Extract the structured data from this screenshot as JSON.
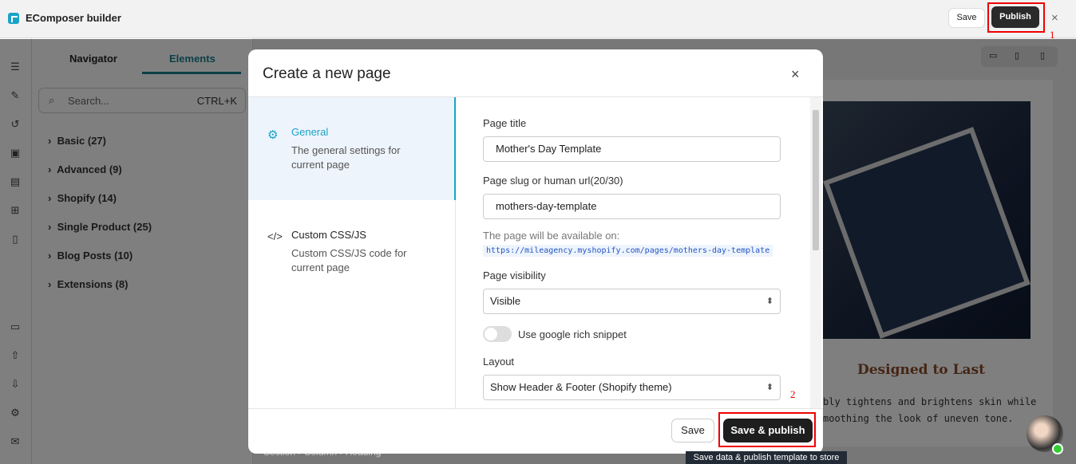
{
  "app": {
    "title": "EComposer builder",
    "save": "Save",
    "publish": "Publish",
    "close": "×",
    "annotation_1": "1"
  },
  "panel": {
    "tabs": [
      "Navigator",
      "Elements"
    ],
    "active_tab": "Elements",
    "search_placeholder": "Search...",
    "search_shortcut": "CTRL+K",
    "categories": [
      "Basic (27)",
      "Advanced (9)",
      "Shopify (14)",
      "Single Product (25)",
      "Blog Posts (10)",
      "Extensions (8)"
    ]
  },
  "canvas": {
    "heading": "Designed to Last",
    "text_lines": [
      "bly tightens and brightens skin while",
      "moothing the look of uneven tone."
    ],
    "breadcrumb": [
      "Section",
      "Column",
      "Heading"
    ]
  },
  "modal": {
    "title": "Create a new page",
    "close": "×",
    "nav": [
      {
        "label": "General",
        "desc": "The general settings for current page",
        "icon": "gear-icon",
        "active": true
      },
      {
        "label": "Custom CSS/JS",
        "desc": "Custom CSS/JS code for current page",
        "icon": "code-icon",
        "active": false
      }
    ],
    "form": {
      "page_title_label": "Page title",
      "page_title": "Mother's Day Template",
      "slug_label": "Page slug or human url(20/30)",
      "slug": "mothers-day-template",
      "available_label": "The page will be available on:",
      "url": "https://mileagency.myshopify.com/pages/mothers-day-template",
      "visibility_label": "Page visibility",
      "visibility": "Visible",
      "rich_snippet_label": "Use google rich snippet",
      "rich_snippet_on": false,
      "layout_label": "Layout",
      "layout": "Show Header & Footer (Shopify theme)"
    },
    "save": "Save",
    "save_publish": "Save & publish",
    "tooltip": "Save data & publish template to store",
    "annotation_2": "2"
  },
  "colors": {
    "accent": "#1aa3c8",
    "highlight": "#ee0000",
    "primary_button": "#1e1e1e"
  }
}
